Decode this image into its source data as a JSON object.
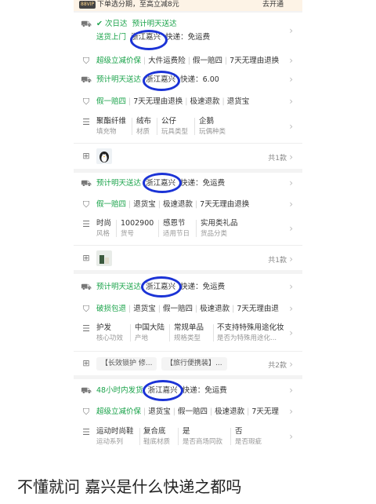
{
  "topbar": {
    "badge": "88VIP",
    "promo": "下单选分期，至高立减8元",
    "open": "去开通"
  },
  "cards": [
    {
      "delivery": {
        "day_badge": "次日达",
        "eta": "预计明天送达",
        "service": "送货上门",
        "region": "浙江嘉兴",
        "shipping": "快递：免运费"
      },
      "guarantee": [
        "超级立减价保",
        "大件运费险",
        "假一赔四",
        "7天无理由退换"
      ],
      "delivery2": {
        "eta": "预计明天送达",
        "region": "浙江嘉兴",
        "shipping": "快递：6.00"
      },
      "guarantee2": [
        "假一赔四",
        "7天无理由退换",
        "极速退款",
        "退货宝"
      ],
      "params": [
        {
          "value": "聚酯纤维",
          "label": "填充物"
        },
        {
          "value": "绒布",
          "label": "材质"
        },
        {
          "value": "公仔",
          "label": "玩具类型"
        },
        {
          "value": "企鹅",
          "label": "玩偶种类"
        }
      ],
      "count": "共1款"
    },
    {
      "delivery": {
        "eta": "预计明天送达",
        "region": "浙江嘉兴",
        "shipping": "快递：免运费"
      },
      "guarantee": [
        "假一赔四",
        "退货宝",
        "极速退款",
        "7天无理由退换"
      ],
      "params": [
        {
          "value": "时尚",
          "label": "风格"
        },
        {
          "value": "1002900",
          "label": "货号"
        },
        {
          "value": "感恩节",
          "label": "适用节日"
        },
        {
          "value": "实用类礼品",
          "label": "货品分类"
        }
      ],
      "count": "共1款"
    },
    {
      "delivery": {
        "eta": "预计明天送达",
        "region": "浙江嘉兴",
        "shipping": "快递：免运费"
      },
      "guarantee": [
        "破损包退",
        "退货宝",
        "假一赔四",
        "极速退款",
        "7天无理由退"
      ],
      "params": [
        {
          "value": "护发",
          "label": "核心功效"
        },
        {
          "value": "中国大陆",
          "label": "产地"
        },
        {
          "value": "常规单品",
          "label": "规格类型"
        },
        {
          "value": "不支持特殊用途化妆",
          "label": "是否为特殊用途化..."
        }
      ],
      "chips": [
        "【长效锁护 修...",
        "【旅行便携装】..."
      ],
      "count": "共2款"
    },
    {
      "delivery": {
        "eta": "48小时内发货",
        "region": "浙江嘉兴",
        "shipping": "快递：免运费"
      },
      "guarantee": [
        "超级立减价保",
        "退货宝",
        "假一赔四",
        "极速退款",
        "7天无理"
      ],
      "params": [
        {
          "value": "运动时尚鞋",
          "label": "运动系列"
        },
        {
          "value": "复合底",
          "label": "鞋底材质"
        },
        {
          "value": "是",
          "label": "是否商场同款"
        },
        {
          "value": "否",
          "label": "是否瑕疵"
        }
      ]
    }
  ],
  "caption": "不懂就问 嘉兴是什么快递之都吗",
  "colors": {
    "green": "#1aa34a",
    "annotation_blue": "#1b33d6"
  }
}
